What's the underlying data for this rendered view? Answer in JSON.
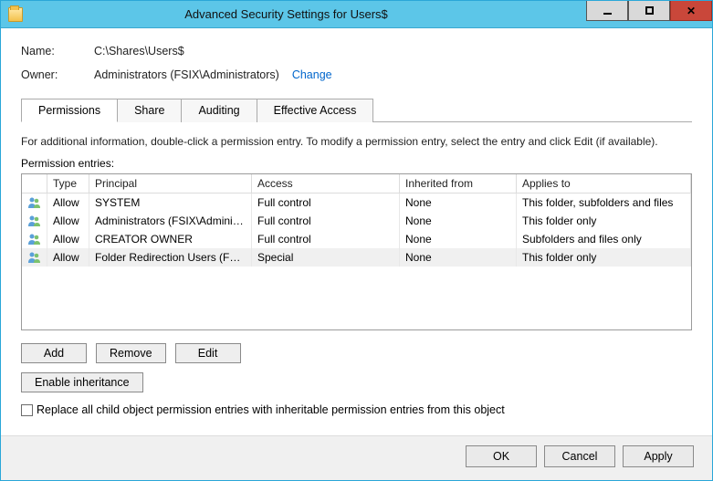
{
  "window": {
    "title": "Advanced Security Settings for Users$"
  },
  "info": {
    "name_label": "Name:",
    "name_value": "C:\\Shares\\Users$",
    "owner_label": "Owner:",
    "owner_value": "Administrators (FSIX\\Administrators)",
    "change_link": "Change"
  },
  "tabs": {
    "permissions": "Permissions",
    "share": "Share",
    "auditing": "Auditing",
    "effective": "Effective Access"
  },
  "instruction": "For additional information, double-click a permission entry. To modify a permission entry, select the entry and click Edit (if available).",
  "entries_label": "Permission entries:",
  "table": {
    "headers": {
      "type": "Type",
      "principal": "Principal",
      "access": "Access",
      "inherited": "Inherited from",
      "applies": "Applies to"
    },
    "rows": [
      {
        "type": "Allow",
        "principal": "SYSTEM",
        "access": "Full control",
        "inherited": "None",
        "applies": "This folder, subfolders and files"
      },
      {
        "type": "Allow",
        "principal": "Administrators (FSIX\\Adminis...",
        "access": "Full control",
        "inherited": "None",
        "applies": "This folder only"
      },
      {
        "type": "Allow",
        "principal": "CREATOR OWNER",
        "access": "Full control",
        "inherited": "None",
        "applies": "Subfolders and files only"
      },
      {
        "type": "Allow",
        "principal": "Folder Redirection Users (FSIX...",
        "access": "Special",
        "inherited": "None",
        "applies": "This folder only"
      }
    ]
  },
  "buttons": {
    "add": "Add",
    "remove": "Remove",
    "edit": "Edit",
    "enable_inheritance": "Enable inheritance",
    "ok": "OK",
    "cancel": "Cancel",
    "apply": "Apply"
  },
  "checkbox_label": "Replace all child object permission entries with inheritable permission entries from this object"
}
